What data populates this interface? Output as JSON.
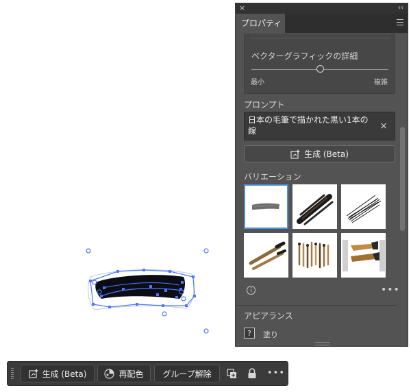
{
  "panel": {
    "tab_title": "プロパティ",
    "vector_detail": {
      "label": "ベクターグラフィックの詳細",
      "min_label": "最小",
      "max_label": "複雑",
      "level": 0.5
    },
    "prompt": {
      "label": "プロンプト",
      "text": "日本の毛筆で描かれた黒い1本の線"
    },
    "generate_label": "生成 (Beta)",
    "variations_label": "バリエーション",
    "appearance": {
      "label": "アピアランス",
      "fill_label": "塗り",
      "fill_badge": "?"
    }
  },
  "toolbar": {
    "generate_label": "生成 (Beta)",
    "recolor_label": "再配色",
    "ungroup_label": "グループ解除"
  },
  "colors": {
    "panel_bg": "#535353",
    "selection_blue": "#4b78ff",
    "active_thumb_border": "#4a90e2"
  }
}
